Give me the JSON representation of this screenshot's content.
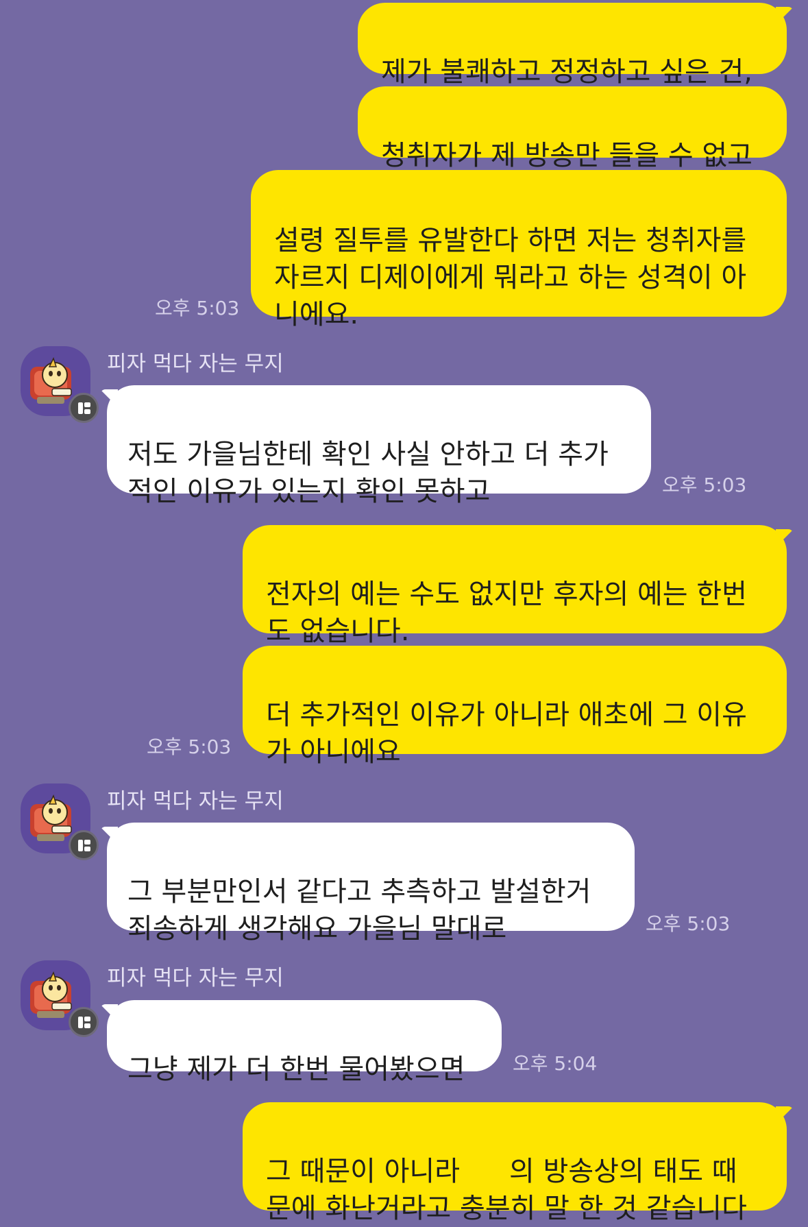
{
  "chat": {
    "sender_name": "피자 먹다 자는 무지",
    "messages": [
      {
        "text": "제가 불쾌하고 정정하고 싶은 건,"
      },
      {
        "text": "청취자가 제 방송만 들을 수 없고"
      },
      {
        "text": "설령 질투를 유발한다 하면 저는 청취자를\n자르지 디제이에게 뭐라고 하는 성격이 아\n니에요.",
        "time": "오후 5:03"
      },
      {
        "text": "저도 가을님한테 확인 사실 안하고 더 추가\n적인 이유가 있는지 확인 못하고",
        "time": "오후 5:03"
      },
      {
        "text": "전자의 예는 수도 없지만 후자의 예는 한번\n도 없습니다."
      },
      {
        "text": "더 추가적인 이유가 아니라 애초에 그 이유\n가 아니에요",
        "time": "오후 5:03"
      },
      {
        "text": "그 부분만인서 같다고 추측하고 발설한거\n죄송하게 생각해요 가을님 말대로",
        "time": "오후 5:03"
      },
      {
        "text": "그냥 제가 더 한번 물어봤으면",
        "time": "오후 5:04"
      },
      {
        "text_before": "그 때문이 아니라",
        "text_after": "의 방송상의 태도 때\n문에 화난거라고 충분히 말 한 것 같습니다"
      }
    ]
  },
  "colors": {
    "background": "#7469a3",
    "my_bubble": "#fee500",
    "their_bubble": "#ffffff",
    "timestamp": "#d6d1ea"
  },
  "icons": {
    "avatar": "muzi-character-avatar",
    "badge": "kakao-channel-badge-icon"
  }
}
